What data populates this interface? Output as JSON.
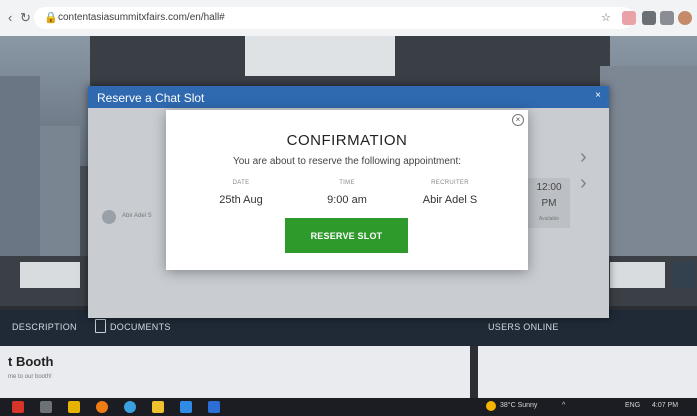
{
  "browser": {
    "url": "contentasiasummitxfairs.com/en/hall#",
    "back_icon": "back-arrow-icon",
    "reload_icon": "reload-icon"
  },
  "chat_dialog": {
    "title": "Reserve a Chat Slot",
    "close_label": "×",
    "recruiter_name": "Abir Adel S",
    "slot_time_hour": "12:00",
    "slot_time_period": "PM",
    "slot_status": "Available"
  },
  "confirmation": {
    "heading": "CONFIRMATION",
    "message": "You are about to reserve the following appointment:",
    "columns": [
      {
        "label": "DATE",
        "value": "25th Aug"
      },
      {
        "label": "TIME",
        "value": "9:00 am"
      },
      {
        "label": "RECRUITER",
        "value": "Abir Adel S"
      }
    ],
    "button_label": "RESERVE SLOT",
    "close_label": "×"
  },
  "page": {
    "tabs": [
      "DESCRIPTION",
      "DOCUMENTS"
    ],
    "users_online": "USERS ONLINE",
    "booth_title": "t Booth",
    "booth_subtitle": "me to our booth!"
  },
  "taskbar": {
    "weather": "38°C Sunny",
    "language": "ENG",
    "clock_time": "4:07 PM"
  },
  "colors": {
    "dialog_header": "#2f69b0",
    "reserve_button": "#2f9a2c"
  }
}
